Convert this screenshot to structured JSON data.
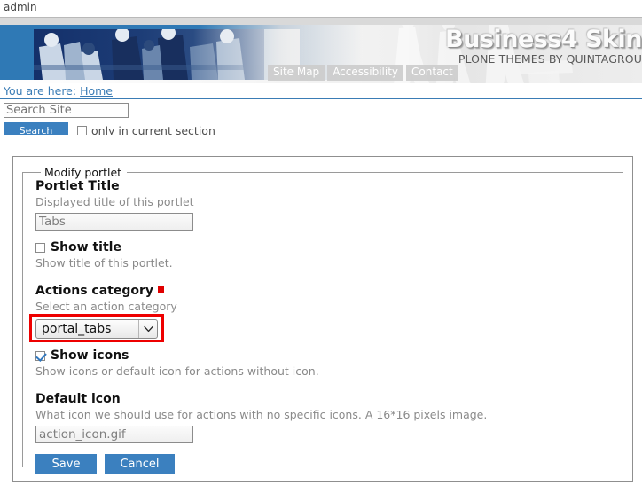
{
  "personal_bar": {
    "user": "admin"
  },
  "banner": {
    "logo_title": "Business4 Skin",
    "logo_subtitle": "PLONE THEMES BY QUINTAGROU",
    "site_actions": [
      {
        "label": "Site Map",
        "name": "site-action-sitemap"
      },
      {
        "label": "Accessibility",
        "name": "site-action-accessibility"
      },
      {
        "label": "Contact",
        "name": "site-action-contact"
      }
    ]
  },
  "breadcrumb": {
    "prefix": "You are here:",
    "home": "Home"
  },
  "search": {
    "placeholder": "Search Site",
    "value": "",
    "button_label": "Search",
    "option_label": "only in current section",
    "option_checked": false
  },
  "form": {
    "legend": "Modify portlet",
    "fields": {
      "portlet_title": {
        "label": "Portlet Title",
        "help": "Displayed title of this portlet",
        "value": "Tabs"
      },
      "show_title": {
        "label": "Show title",
        "help": "Show title of this portlet.",
        "checked": false
      },
      "actions_category": {
        "label": "Actions category",
        "required": true,
        "help": "Select an action category",
        "value": "portal_tabs",
        "options": [
          "portal_tabs"
        ],
        "highlight_color": "#ee0000"
      },
      "show_icons": {
        "label": "Show icons",
        "help": "Show icons or default icon for actions without icon.",
        "checked": true
      },
      "default_icon": {
        "label": "Default icon",
        "help": "What icon we should use for actions with no specific icons. A 16*16 pixels image.",
        "value": "action_icon.gif"
      }
    },
    "buttons": {
      "save": "Save",
      "cancel": "Cancel"
    }
  },
  "colors": {
    "accent_blue": "#3b80bf",
    "banner_blue": "#2f79b5",
    "link_blue": "#3a7cb5",
    "required_red": "#e00000"
  }
}
